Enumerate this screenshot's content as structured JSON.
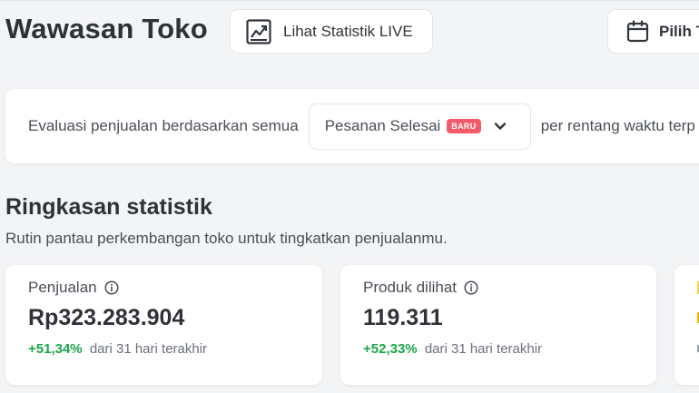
{
  "header": {
    "title": "Wawasan Toko",
    "live_button_label": "Lihat Statistik LIVE",
    "range_button_label": "Pilih T"
  },
  "filter": {
    "prefix_text": "Evaluasi penjualan berdasarkan semua",
    "selected_value": "Pesanan Selesai",
    "new_badge": "BARU",
    "suffix_text": "per rentang waktu terp"
  },
  "summary": {
    "title": "Ringkasan statistik",
    "subtitle": "Rutin pantau perkembangan toko untuk tingkatkan penjualanmu.",
    "cards": [
      {
        "label": "Penjualan",
        "value": "Rp323.283.904",
        "change": "+51,34%",
        "period": "dari 31 hari terakhir"
      },
      {
        "label": "Produk dilihat",
        "value": "119.311",
        "change": "+52,33%",
        "period": "dari 31 hari terakhir"
      }
    ]
  },
  "colors": {
    "background": "#f3f4f5",
    "badge": "#f25b67",
    "positive_change": "#1ba64a",
    "peek_accent_top": "#f6d44a",
    "peek_accent_bottom": "#f0b400"
  },
  "icons": {
    "live_button_icon": "trend-chart-icon",
    "range_button_icon": "calendar-icon",
    "select_icon": "chevron-down-icon",
    "card_label_icon": "info-icon"
  }
}
